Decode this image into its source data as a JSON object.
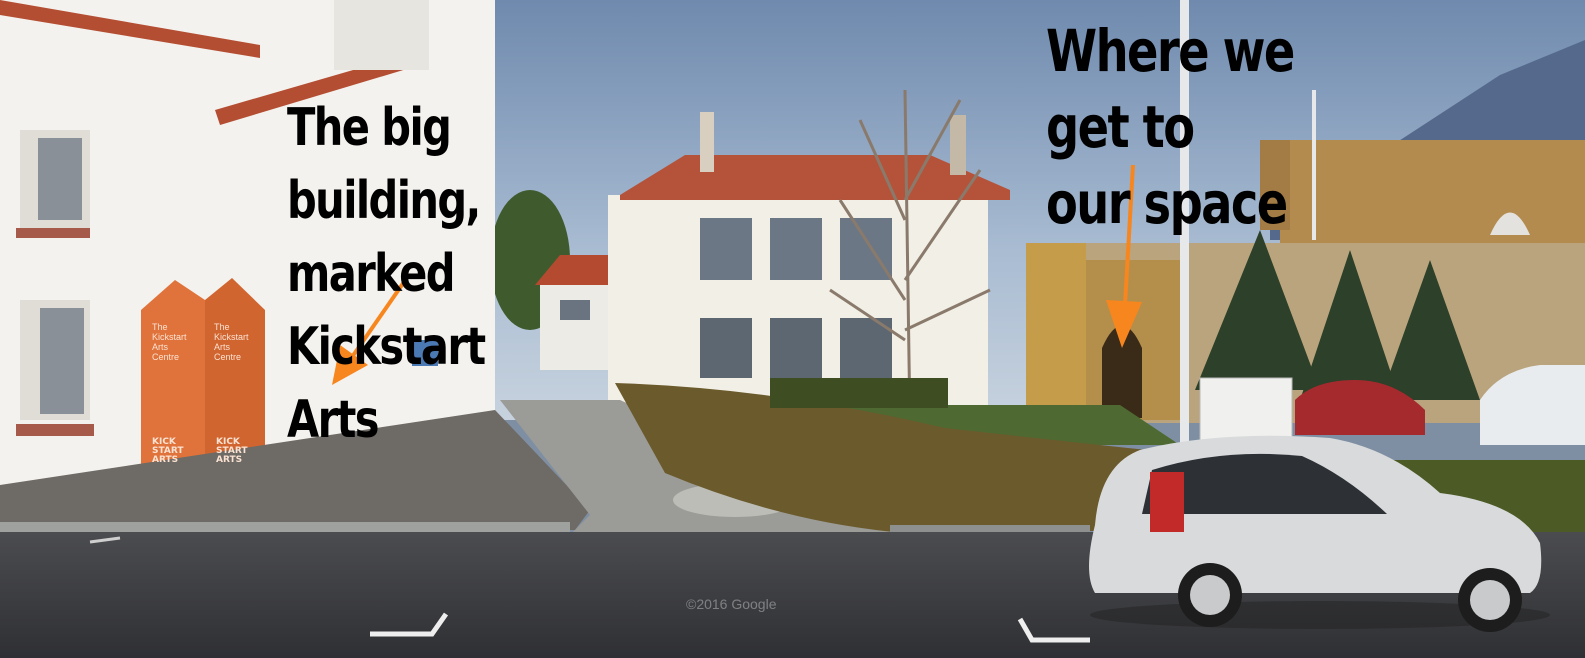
{
  "annotations": {
    "big_building_label": "The big building,\nmarked Kickstart\nArts",
    "entrance_label": "Where we get to\nour space",
    "arrow_color": "#f7861f"
  },
  "sign": {
    "left_face": "The\nKickstart\nArts\nCentre",
    "right_face": "The\nKickstart\nArts\nCentre",
    "logo": "KICK\nSTART\nARTS",
    "color": "#e0733b"
  },
  "watermark": "©2016 Google",
  "photo": {
    "sky_color": "#9db2cc",
    "road_color": "#3c3d40",
    "building_color": "#f3f0ea",
    "hedge_color": "#6b5a2c",
    "car_color": "#d9dadc"
  }
}
